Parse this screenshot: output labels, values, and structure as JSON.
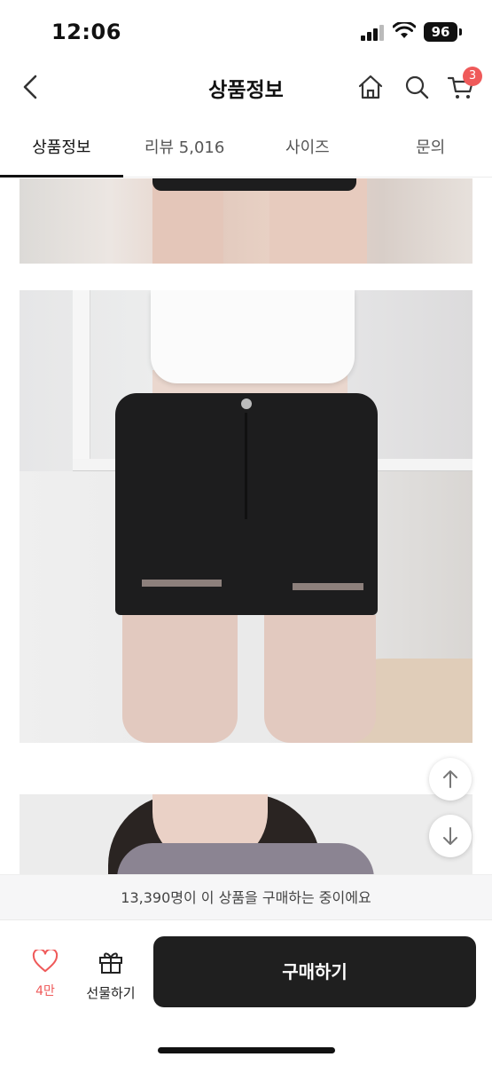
{
  "status_bar": {
    "time": "12:06",
    "battery": "96"
  },
  "header": {
    "title": "상품정보",
    "back_icon": "chevron-left-icon",
    "home_icon": "home-icon",
    "search_icon": "search-icon",
    "cart_icon": "cart-icon",
    "cart_count": "3"
  },
  "tabs": [
    {
      "label": "상품정보",
      "active": true
    },
    {
      "label": "리뷰 5,016",
      "active": false
    },
    {
      "label": "사이즈",
      "active": false
    },
    {
      "label": "문의",
      "active": false
    }
  ],
  "scroll_buttons": {
    "up_icon": "arrow-up-icon",
    "down_icon": "arrow-down-icon"
  },
  "notice": "13,390명이 이 상품을 구매하는 중이에요",
  "bottom_bar": {
    "like_icon": "heart-icon",
    "like_count": "4만",
    "gift_icon": "gift-icon",
    "gift_label": "선물하기",
    "buy_label": "구매하기"
  },
  "colors": {
    "accent": "#ef5a5a",
    "buy_button": "#1f1f1f"
  }
}
